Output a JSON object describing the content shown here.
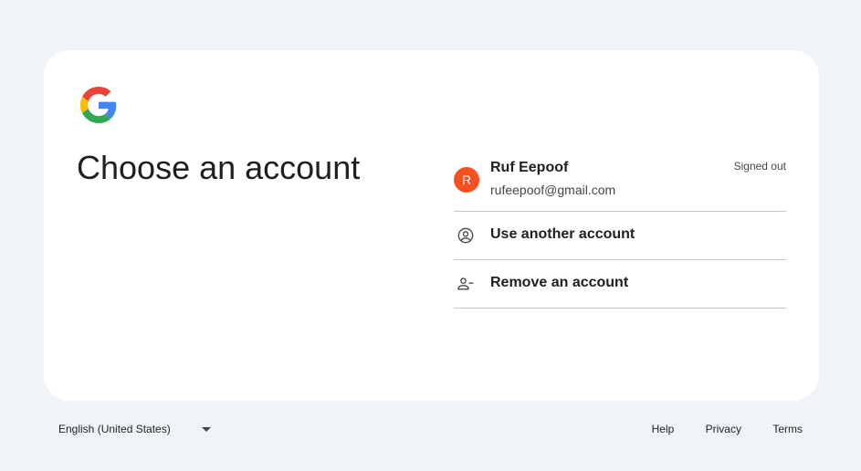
{
  "header": {
    "title": "Choose an account"
  },
  "account": {
    "avatar_initial": "R",
    "avatar_color": "#f4511e",
    "name": "Ruf Eepoof",
    "email": "rufeepoof@gmail.com",
    "status": "Signed out"
  },
  "options": {
    "use_another": {
      "label": "Use another account",
      "icon": "account-circle-icon"
    },
    "remove": {
      "label": "Remove an account",
      "icon": "person-remove-icon"
    }
  },
  "footer": {
    "language": "English (United States)",
    "links": {
      "help": "Help",
      "privacy": "Privacy",
      "terms": "Terms"
    }
  },
  "colors": {
    "background": "#f0f4f9",
    "card": "#ffffff",
    "divider": "#c4c7c5"
  }
}
